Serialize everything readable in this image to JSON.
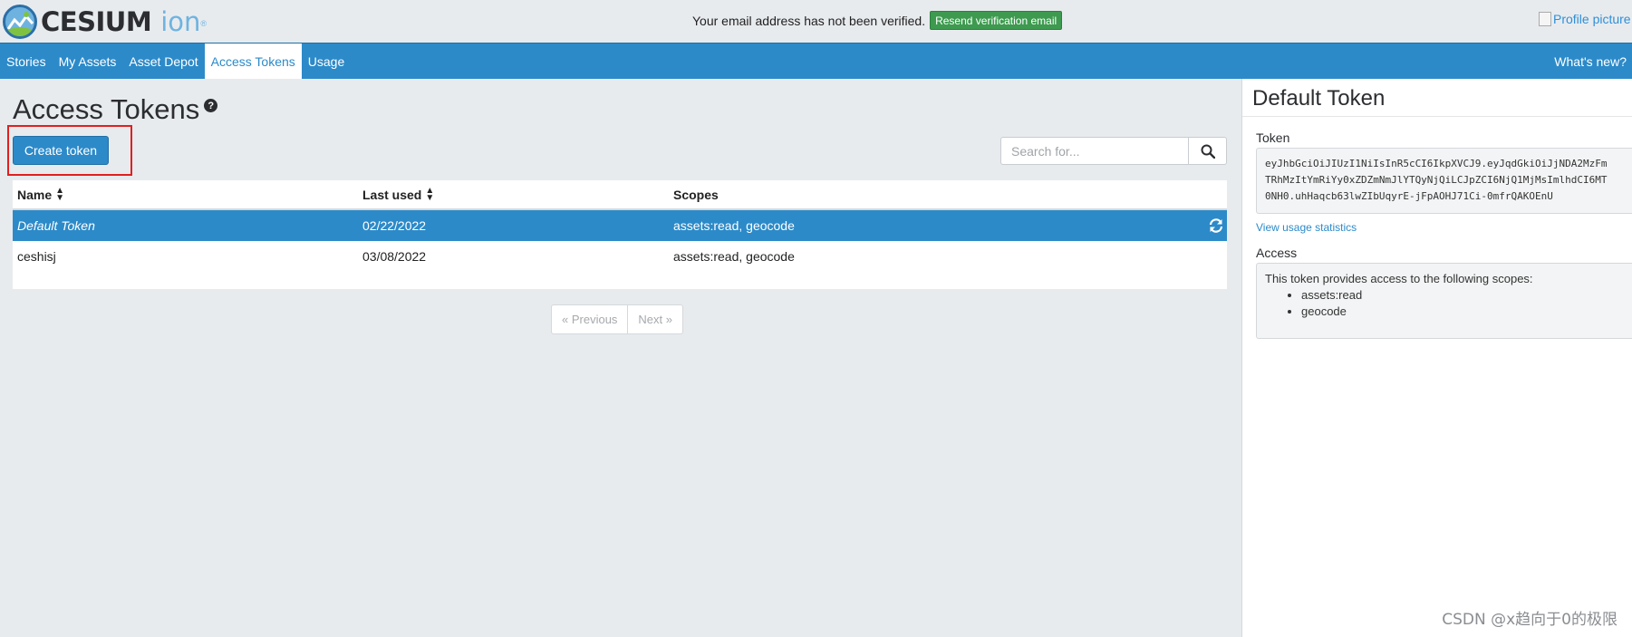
{
  "brand": {
    "logo_text": "CESIUM",
    "logo_suffix": "ion",
    "logo_mark": "®",
    "colors": {
      "primary": "#2c8ac9",
      "success": "#3d9a4f",
      "highlight": "#e02020"
    }
  },
  "verification": {
    "message": "Your email address has not been verified.",
    "button_label": "Resend verification email"
  },
  "profile": {
    "alt_text": "Profile picture"
  },
  "nav": {
    "items": [
      {
        "label": "Stories"
      },
      {
        "label": "My Assets"
      },
      {
        "label": "Asset Depot"
      },
      {
        "label": "Access Tokens",
        "active": true
      },
      {
        "label": "Usage"
      }
    ],
    "right_label": "What's new?"
  },
  "page": {
    "title": "Access Tokens",
    "help_icon": "question-circle-icon",
    "create_button": "Create token",
    "search_placeholder": "Search for..."
  },
  "table": {
    "columns": [
      "Name",
      "Last used",
      "Scopes"
    ],
    "rows": [
      {
        "name": "Default Token",
        "last_used": "02/22/2022",
        "scopes": "assets:read, geocode",
        "selected": true
      },
      {
        "name": "ceshisj",
        "last_used": "03/08/2022",
        "scopes": "assets:read, geocode",
        "selected": false
      }
    ]
  },
  "pagination": {
    "previous": "« Previous",
    "next": "Next »"
  },
  "panel": {
    "title": "Default Token",
    "token_label": "Token",
    "token_lines": [
      "eyJhbGciOiJIUzI1NiIsInR5cCI6IkpXVCJ9.eyJqdGkiOiJjNDA2MzFm",
      "TRhMzItYmRiYy0xZDZmNmJlYTQyNjQiLCJpZCI6NjQ1MjMsImlhdCI6MT",
      "0NH0.uhHaqcb63lwZIbUqyrE-jFpAOHJ71Ci-0mfrQAKOEnU"
    ],
    "usage_link": "View usage statistics",
    "access_label": "Access",
    "access_intro": "This token provides access to the following scopes:",
    "scopes": [
      "assets:read",
      "geocode"
    ]
  },
  "watermark": "CSDN @x趋向于0的极限"
}
